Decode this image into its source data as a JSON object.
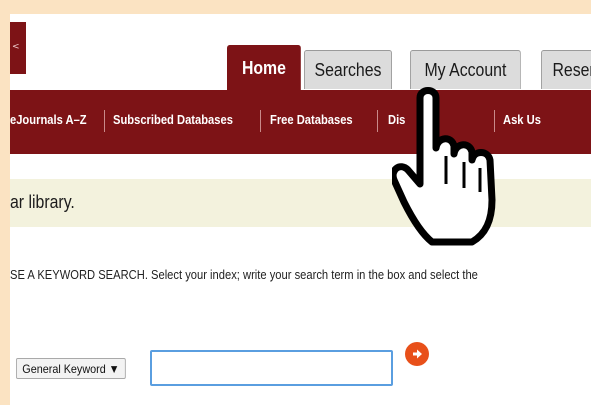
{
  "header": {
    "brand_glyph": "<"
  },
  "tabs": [
    {
      "label": "Home",
      "active": true
    },
    {
      "label": "Searches",
      "active": false
    },
    {
      "label": "My Account",
      "active": false
    },
    {
      "label": "Reserve",
      "active": false
    }
  ],
  "nav": {
    "items": [
      {
        "label": "eJournals A–Z"
      },
      {
        "label": "Subscribed Databases"
      },
      {
        "label": "Free Databases"
      },
      {
        "label": "Dis"
      },
      {
        "label": "Ask Us"
      }
    ]
  },
  "welcome": {
    "text": "ar library."
  },
  "search": {
    "instruction": "SE A KEYWORD SEARCH. Select your index; write your search term in the box and select the",
    "index_value": "General Keyword ▼",
    "input_value": "",
    "go_icon": "arrow-right-circle-icon"
  },
  "colors": {
    "brand": "#7d1316",
    "go_button": "#e8501a",
    "welcome_bg": "#f3f2dd",
    "frame_bg": "#fbe3c2"
  },
  "cursor": {
    "icon": "pointing-hand-cursor-icon"
  }
}
